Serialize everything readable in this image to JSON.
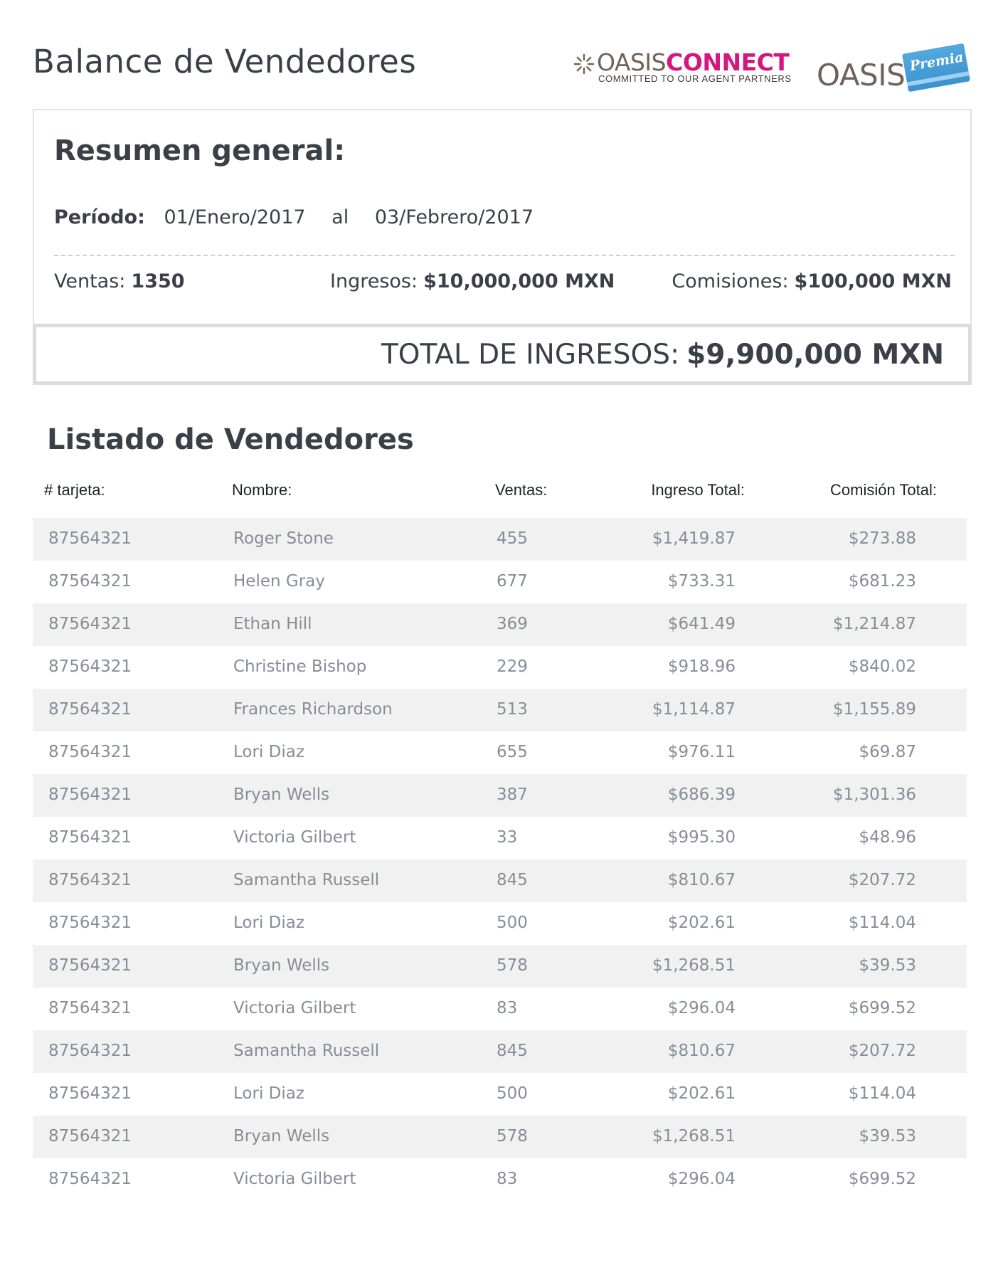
{
  "header": {
    "title": "Balance de Vendedores",
    "logo_connect": {
      "word_oasis": "OASIS",
      "word_connect": "CONNECT",
      "tagline": "COMMITTED TO OUR AGENT PARTNERS",
      "color_connect": "#d4167d",
      "color_oasis": "#6f6258"
    },
    "logo_premia": {
      "word_oasis": "OASIS",
      "word_premia": "Premia",
      "color_card": "#3c92cf"
    }
  },
  "summary": {
    "heading": "Resumen general:",
    "period_label": "Período:",
    "period_start": "01/Enero/2017",
    "period_connector": "al",
    "period_end": "03/Febrero/2017",
    "ventas_label": "Ventas:",
    "ventas_value": "1350",
    "ingresos_label": "Ingresos:",
    "ingresos_value": "$10,000,000 MXN",
    "comisiones_label": "Comisiones:",
    "comisiones_value": "$100,000 MXN",
    "total_label": "TOTAL DE INGRESOS:",
    "total_value": "$9,900,000 MXN"
  },
  "list": {
    "heading": "Listado de Vendedores",
    "columns": [
      "# tarjeta:",
      "Nombre:",
      "Ventas:",
      "Ingreso Total:",
      "Comisión Total:"
    ],
    "rows": [
      [
        "87564321",
        "Roger Stone",
        "455",
        "$1,419.87",
        "$273.88"
      ],
      [
        "87564321",
        "Helen Gray",
        "677",
        "$733.31",
        "$681.23"
      ],
      [
        "87564321",
        "Ethan Hill",
        "369",
        "$641.49",
        "$1,214.87"
      ],
      [
        "87564321",
        "Christine Bishop",
        "229",
        "$918.96",
        "$840.02"
      ],
      [
        "87564321",
        "Frances Richardson",
        "513",
        "$1,114.87",
        "$1,155.89"
      ],
      [
        "87564321",
        "Lori Diaz",
        "655",
        "$976.11",
        "$69.87"
      ],
      [
        "87564321",
        "Bryan Wells",
        "387",
        "$686.39",
        "$1,301.36"
      ],
      [
        "87564321",
        "Victoria Gilbert",
        "33",
        "$995.30",
        "$48.96"
      ],
      [
        "87564321",
        "Samantha Russell",
        "845",
        "$810.67",
        "$207.72"
      ],
      [
        "87564321",
        "Lori Diaz",
        "500",
        "$202.61",
        "$114.04"
      ],
      [
        "87564321",
        "Bryan Wells",
        "578",
        "$1,268.51",
        "$39.53"
      ],
      [
        "87564321",
        "Victoria Gilbert",
        "83",
        "$296.04",
        "$699.52"
      ],
      [
        "87564321",
        "Samantha Russell",
        "845",
        "$810.67",
        "$207.72"
      ],
      [
        "87564321",
        "Lori Diaz",
        "500",
        "$202.61",
        "$114.04"
      ],
      [
        "87564321",
        "Bryan Wells",
        "578",
        "$1,268.51",
        "$39.53"
      ],
      [
        "87564321",
        "Victoria Gilbert",
        "83",
        "$296.04",
        "$699.52"
      ]
    ]
  }
}
